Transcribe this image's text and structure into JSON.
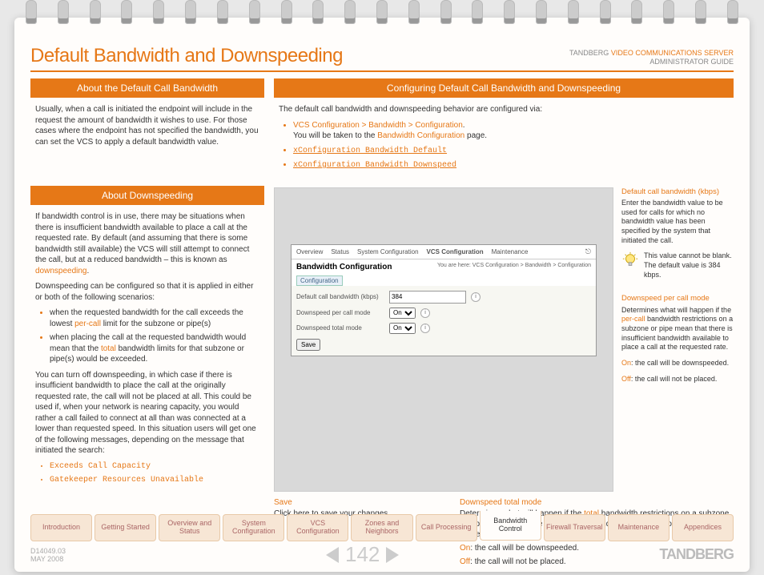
{
  "header": {
    "title": "Default Bandwidth and Downspeeding",
    "product_prefix": "TANDBERG ",
    "product_name": "VIDEO COMMUNICATIONS SERVER",
    "product_sub": "ADMINISTRATOR GUIDE"
  },
  "left": {
    "band1": "About the Default Call Bandwidth",
    "about_default": "Usually, when a call is initiated the endpoint will include in the request the amount of bandwidth it wishes to use.  For those cases where the endpoint has not specified the bandwidth, you can set the VCS to apply a default bandwidth value.",
    "band2": "About Downspeeding",
    "ds_p1a": "If bandwidth control is in use, there may be situations when there is insufficient bandwidth available to place a call at the requested rate.  By default (and assuming that there is some bandwidth still available) the VCS will still attempt to connect the call, but at a reduced bandwidth – this is known as ",
    "ds_term": "downspeeding",
    "ds_p1b": ".",
    "ds_p2": "Downspeeding can be configured so that it is applied in either or both of the following scenarios:",
    "ds_b1a": "when the requested bandwidth for the call exceeds the lowest ",
    "ds_b1_link": "per-call",
    "ds_b1b": " limit for the subzone or pipe(s)",
    "ds_b2a": "when placing the call at the requested bandwidth would mean that the ",
    "ds_b2_link": "total",
    "ds_b2b": " bandwidth limits for that subzone or pipe(s) would be exceeded.",
    "ds_p3": "You can turn off downspeeding, in which case if there is insufficient bandwidth to place the call at the originally requested rate, the call will not be placed at all.  This could be used if, when your network is nearing capacity, you would rather a call failed to connect at all than was connected at a lower than requested speed. In this situation users will get one of the following messages, depending on the message that initiated the search:",
    "msg1": "Exceeds Call Capacity",
    "msg2": "Gatekeeper Resources Unavailable"
  },
  "right": {
    "band": "Configuring Default Call Bandwidth and Downspeeding",
    "intro": "The default call bandwidth and downspeeding behavior are configured via:",
    "nav_path": "VCS Configuration > Bandwidth > Configuration",
    "nav_suffix": ".",
    "nav_line2a": "You will be taken to the ",
    "nav_line2_link": "Bandwidth Configuration",
    "nav_line2b": " page.",
    "cmd1": "xConfiguration Bandwidth Default",
    "cmd2": "xConfiguration Bandwidth Downspeed"
  },
  "screenshot": {
    "tabs": [
      "Overview",
      "Status",
      "System Configuration",
      "VCS Configuration",
      "Maintenance"
    ],
    "active_tab": "VCS Configuration",
    "title": "Bandwidth Configuration",
    "breadcrumb": "You are here: VCS Configuration > Bandwidth > Configuration",
    "subtab": "Configuration",
    "row1_label": "Default call bandwidth (kbps)",
    "row1_value": "384",
    "row2_label": "Downspeed per call mode",
    "row2_value": "On",
    "row3_label": "Downspeed total mode",
    "row3_value": "On",
    "save": "Save"
  },
  "callouts": {
    "c1_title": "Default call bandwidth (kbps)",
    "c1_body": "Enter the bandwidth value to be used for calls for which no bandwidth value has been specified by the system that initiated the call.",
    "bulb_note": "This value cannot be blank.  The default value is 384 kbps.",
    "c2_title": "Downspeed per call mode",
    "c2_body_a": "Determines what will happen if the ",
    "c2_link": "per-call",
    "c2_body_b": " bandwidth restrictions on a subzone or pipe mean that there is insufficient bandwidth available to place a call at the requested rate.",
    "c2_on": "On",
    "c2_on_t": ": the call will be downspeeded.",
    "c2_off": "Off",
    "c2_off_t": ": the call will not be placed."
  },
  "below": {
    "save_title": "Save",
    "save_body": "Click here to save your changes",
    "total_title": "Downspeed total mode",
    "total_body_a": "Determines what will happen if the ",
    "total_link": "total",
    "total_body_b": " bandwidth restrictions on a subzone or pipe mean that there is insufficient bandwidth available to place a call at the requested rate.",
    "total_on": "On",
    "total_on_t": ": the call will be downspeeded.",
    "total_off": "Off",
    "total_off_t": ": the call will not be placed."
  },
  "footer": {
    "tabs": [
      "Introduction",
      "Getting Started",
      "Overview and Status",
      "System Configuration",
      "VCS Configuration",
      "Zones and Neighbors",
      "Call Processing",
      "Bandwidth Control",
      "Firewall Traversal",
      "Maintenance",
      "Appendices"
    ],
    "active_index": 7,
    "doc_id": "D14049.03",
    "doc_date": "MAY 2008",
    "page": "142",
    "brand": "TANDBERG"
  }
}
